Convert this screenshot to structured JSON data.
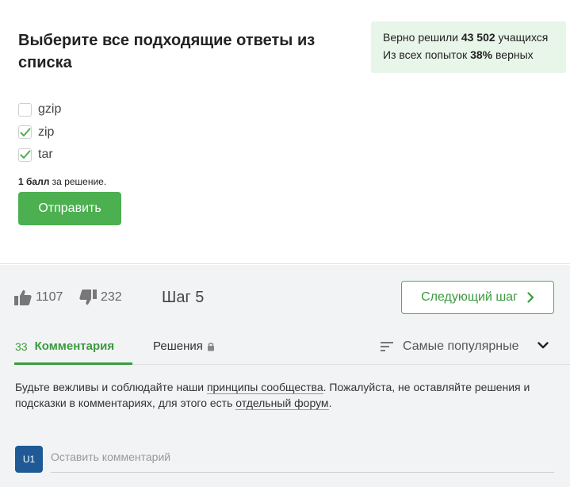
{
  "quiz": {
    "question": "Выберите все подходящие ответы из списка",
    "stats": {
      "line1_prefix": "Верно решили ",
      "solved_count": "43 502",
      "line1_suffix": " учащихся",
      "line2_prefix": "Из всех попыток ",
      "percent": "38%",
      "line2_suffix": " верных"
    },
    "options": [
      {
        "label": "gzip",
        "checked": false
      },
      {
        "label": "zip",
        "checked": true
      },
      {
        "label": "tar",
        "checked": true
      }
    ],
    "score_bold": "1 балл",
    "score_rest": " за решение.",
    "submit_label": "Отправить"
  },
  "footer": {
    "likes": "1107",
    "dislikes": "232",
    "step_label": "Шаг 5",
    "next_label": "Следующий шаг",
    "tabs": {
      "comments_count": "33",
      "comments_label": "Комментария",
      "solutions_label": "Решения",
      "sort_label": "Самые популярные"
    },
    "notice": {
      "part1": "Будьте вежливы и соблюдайте наши ",
      "link1": "принципы сообщества",
      "part2": ". Пожалуйста, не оставляйте решения и подсказки в комментариях, для этого есть ",
      "link2": "отдельный форум",
      "part3": "."
    },
    "avatar_initials": "U1",
    "comment_placeholder": "Оставить комментарий"
  },
  "colors": {
    "accent_green": "#4caf50",
    "stats_bg": "#e8f5e9",
    "avatar_blue": "#1f5a96"
  },
  "icons": [
    "check-icon",
    "thumbs-up-icon",
    "thumbs-down-icon",
    "chevron-right-icon",
    "lock-icon",
    "sort-lines-icon",
    "chevron-down-icon"
  ]
}
